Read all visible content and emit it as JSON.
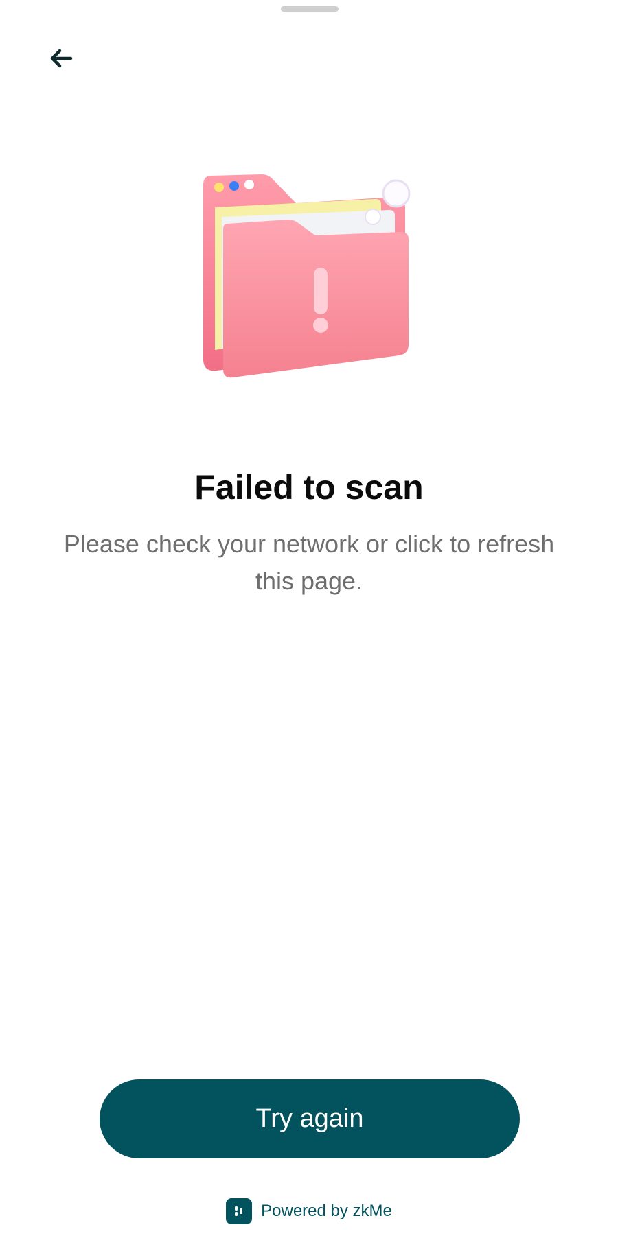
{
  "header": {
    "back_icon": "arrow-left-icon"
  },
  "illustration": {
    "icon": "folder-warning-icon",
    "colors": {
      "folder": "#f7a0ad",
      "paper_yellow": "#f7f1a8",
      "paper_white": "#f1f3f6"
    }
  },
  "message": {
    "title": "Failed to scan",
    "subtitle": "Please check your network or click to refresh this page."
  },
  "actions": {
    "try_again_label": "Try again"
  },
  "footer": {
    "logo_icon": "zkme-logo-icon",
    "powered_by": "Powered by zkMe"
  },
  "colors": {
    "accent": "#03535e",
    "title": "#0b0b0b",
    "subtitle": "#6e6e6e",
    "handle": "#cfcfcf"
  }
}
